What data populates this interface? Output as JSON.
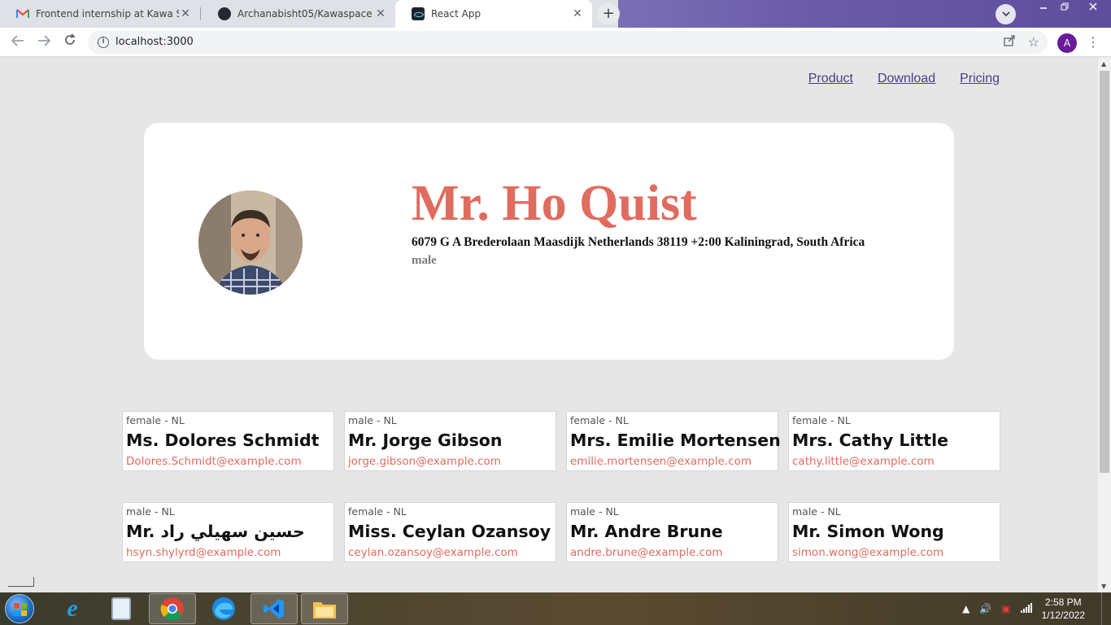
{
  "browser": {
    "tabs": [
      {
        "title": "Frontend internship at Kawa Space",
        "icon": "gmail-icon",
        "active": false
      },
      {
        "title": "Archanabisht05/Kawaspace",
        "icon": "github-icon",
        "active": false
      },
      {
        "title": "React App",
        "icon": "react-icon",
        "active": true
      }
    ],
    "close_glyph": "✕",
    "new_tab_glyph": "+",
    "url": "localhost:3000",
    "profile_initial": "A"
  },
  "page": {
    "nav": [
      {
        "label": "Product"
      },
      {
        "label": "Download"
      },
      {
        "label": "Pricing"
      }
    ],
    "hero": {
      "name": "Mr. Ho Quist",
      "address": "6079 G A Brederolaan Maasdijk Netherlands 38119 +2:00 Kaliningrad, South Africa",
      "gender": "male"
    },
    "cards": [
      {
        "meta": "female - NL",
        "name": "Ms. Dolores Schmidt",
        "email": "Dolores.Schmidt@example.com"
      },
      {
        "meta": "male - NL",
        "name": "Mr. Jorge Gibson",
        "email": "jorge.gibson@example.com"
      },
      {
        "meta": "female - NL",
        "name": "Mrs. Emilie Mortensen",
        "email": "emilie.mortensen@example.com"
      },
      {
        "meta": "female - NL",
        "name": "Mrs. Cathy Little",
        "email": "cathy.little@example.com"
      },
      {
        "meta": "male - NL",
        "name": "Mr. حسين سهيلي راد",
        "email": "hsyn.shylyrd@example.com"
      },
      {
        "meta": "female - NL",
        "name": "Miss. Ceylan Ozansoy",
        "email": "ceylan.ozansoy@example.com"
      },
      {
        "meta": "male - NL",
        "name": "Mr. Andre Brune",
        "email": "andre.brune@example.com"
      },
      {
        "meta": "male - NL",
        "name": "Mr. Simon Wong",
        "email": "simon.wong@example.com"
      }
    ],
    "accent_color": "#e06b5f",
    "link_color": "#4b3a8a"
  },
  "taskbar": {
    "apps": [
      "internet-explorer-icon",
      "media-player-icon",
      "chrome-icon",
      "edge-icon",
      "vscode-icon",
      "file-explorer-icon"
    ],
    "time": "2:58 PM",
    "date": "1/12/2022"
  }
}
